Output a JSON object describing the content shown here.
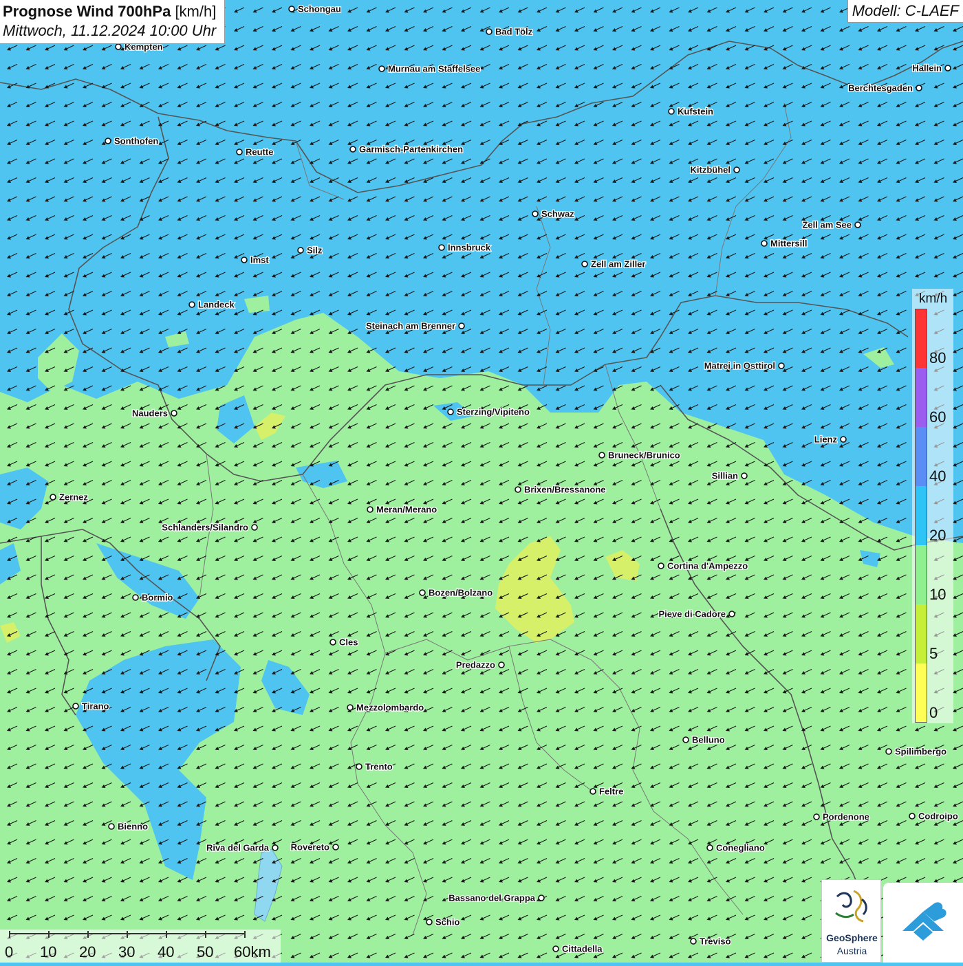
{
  "title": {
    "bold": "Prognose Wind 700hPa",
    "unit": "[km/h]",
    "datetime": "Mittwoch, 11.12.2024 10:00 Uhr"
  },
  "model": "Modell: C-LAEF",
  "legend": {
    "unit": "km/h",
    "labels": [
      "80",
      "60",
      "40",
      "20",
      "10",
      "5",
      "0"
    ],
    "colors": [
      "#ff3535",
      "#9b5cf0",
      "#5b8ef5",
      "#2ec4f5",
      "#8ff08f",
      "#c6ef3a",
      "#ffff55"
    ]
  },
  "scale": {
    "labels": [
      "0",
      "10",
      "20",
      "30",
      "40",
      "50",
      "60km"
    ]
  },
  "colors": {
    "blue_field": "#4fc4f0",
    "green_field": "#9ef09e",
    "yellow_field": "#d6f06a",
    "border": "#555555",
    "arrow": "#1a1a1a"
  },
  "wind": {
    "direction": "from north-east",
    "arrow_icon": "arrow-down-left-icon"
  },
  "cities": [
    {
      "name": "Schongau"
    },
    {
      "name": "Bad Tölz"
    },
    {
      "name": "Kempten"
    },
    {
      "name": "Hallein"
    },
    {
      "name": "Murnau am Staffelsee"
    },
    {
      "name": "Berchtesgaden"
    },
    {
      "name": "Kufstein"
    },
    {
      "name": "Sonthofen"
    },
    {
      "name": "Reutte"
    },
    {
      "name": "Garmisch-Partenkirchen"
    },
    {
      "name": "Kitzbühel"
    },
    {
      "name": "Schwaz"
    },
    {
      "name": "Zell am See"
    },
    {
      "name": "Mittersill"
    },
    {
      "name": "Innsbruck"
    },
    {
      "name": "Silz"
    },
    {
      "name": "Imst"
    },
    {
      "name": "Zell am Ziller"
    },
    {
      "name": "Landeck"
    },
    {
      "name": "Steinach am Brenner"
    },
    {
      "name": "Matrei in Osttirol"
    },
    {
      "name": "Nauders"
    },
    {
      "name": "Sterzing/Vipiteno"
    },
    {
      "name": "Lienz"
    },
    {
      "name": "Bruneck/Brunico"
    },
    {
      "name": "Sillian"
    },
    {
      "name": "Brixen/Bressanone"
    },
    {
      "name": "Zernez"
    },
    {
      "name": "Meran/Merano"
    },
    {
      "name": "Schlanders/Silandro"
    },
    {
      "name": "Cortina d'Ampezzo"
    },
    {
      "name": "Bozen/Bolzano"
    },
    {
      "name": "Bormio"
    },
    {
      "name": "Pieve di Cadore"
    },
    {
      "name": "Cles"
    },
    {
      "name": "Predazzo"
    },
    {
      "name": "Tirano"
    },
    {
      "name": "Mezzolombardo"
    },
    {
      "name": "Belluno"
    },
    {
      "name": "Spilimbergo"
    },
    {
      "name": "Trento"
    },
    {
      "name": "Feltre"
    },
    {
      "name": "Pordenone"
    },
    {
      "name": "Codroipo"
    },
    {
      "name": "Bienno"
    },
    {
      "name": "Riva del Garda"
    },
    {
      "name": "Rovereto"
    },
    {
      "name": "Conegliano"
    },
    {
      "name": "Bassano del Grappa"
    },
    {
      "name": "Schio"
    },
    {
      "name": "Treviso"
    },
    {
      "name": "Cittadella"
    }
  ],
  "logos": {
    "geosphere_line1": "GeoSphere",
    "geosphere_line2": "Austria"
  }
}
